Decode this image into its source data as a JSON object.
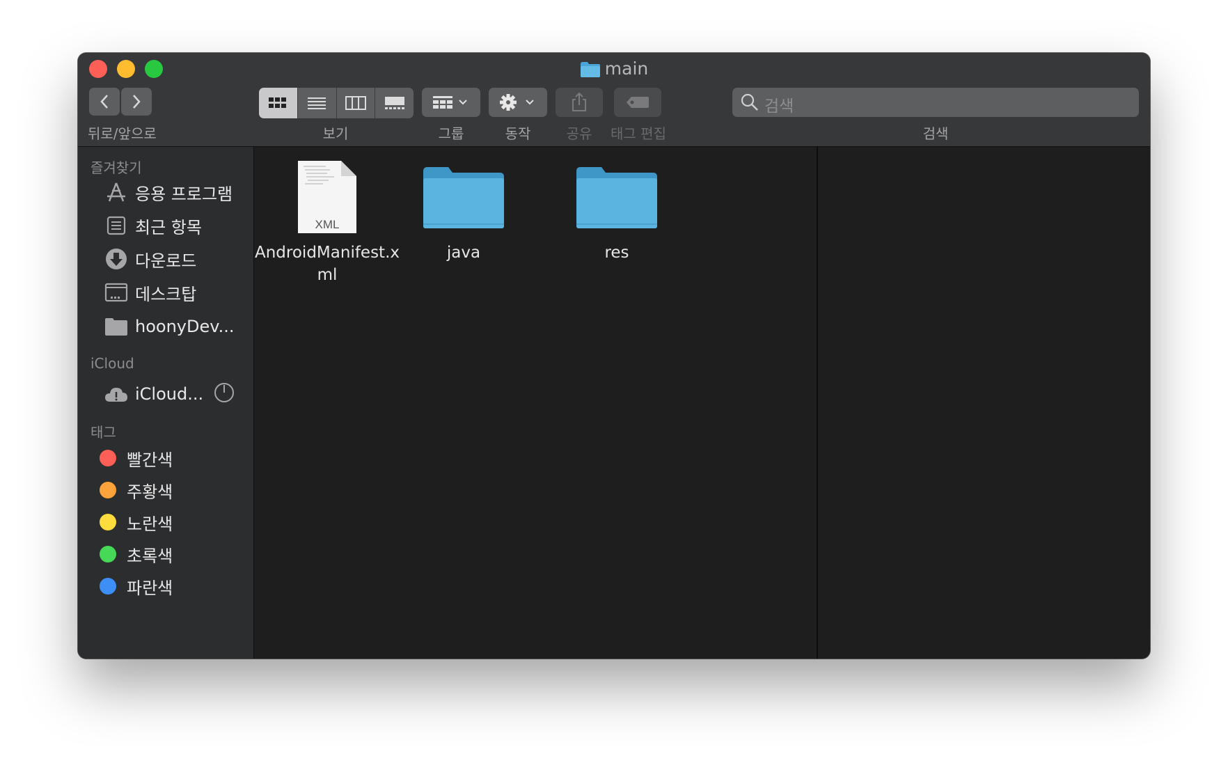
{
  "window": {
    "title": "main"
  },
  "toolbar": {
    "back_forward_label": "뒤로/앞으로",
    "view_label": "보기",
    "group_label": "그룹",
    "action_label": "동작",
    "share_label": "공유",
    "edit_tags_label": "태그 편집",
    "search_label": "검색",
    "search_placeholder": "검색"
  },
  "sidebar": {
    "favorites_title": "즐겨찾기",
    "favorites": [
      {
        "label": "응용 프로그램",
        "icon": "applications-icon"
      },
      {
        "label": "최근 항목",
        "icon": "recents-icon"
      },
      {
        "label": "다운로드",
        "icon": "downloads-icon"
      },
      {
        "label": "데스크탑",
        "icon": "desktop-icon"
      },
      {
        "label": "hoonyDev...",
        "icon": "folder-icon"
      }
    ],
    "icloud_title": "iCloud",
    "icloud": [
      {
        "label": "iCloud...",
        "icon": "icloud-warning-icon"
      }
    ],
    "tags_title": "태그",
    "tags": [
      {
        "label": "빨간색",
        "color": "#fe5f57"
      },
      {
        "label": "주황색",
        "color": "#fea33b"
      },
      {
        "label": "노란색",
        "color": "#fedc3e"
      },
      {
        "label": "초록색",
        "color": "#46d957"
      },
      {
        "label": "파란색",
        "color": "#3d8ff7"
      }
    ]
  },
  "files": [
    {
      "name": "AndroidManifest.xml",
      "type": "xml",
      "badge": "XML"
    },
    {
      "name": "java",
      "type": "folder"
    },
    {
      "name": "res",
      "type": "folder"
    }
  ],
  "colors": {
    "folder_blue": "#5bb3e0",
    "window_bg": "#1e1e1f",
    "sidebar_bg": "#2c2d2f"
  }
}
